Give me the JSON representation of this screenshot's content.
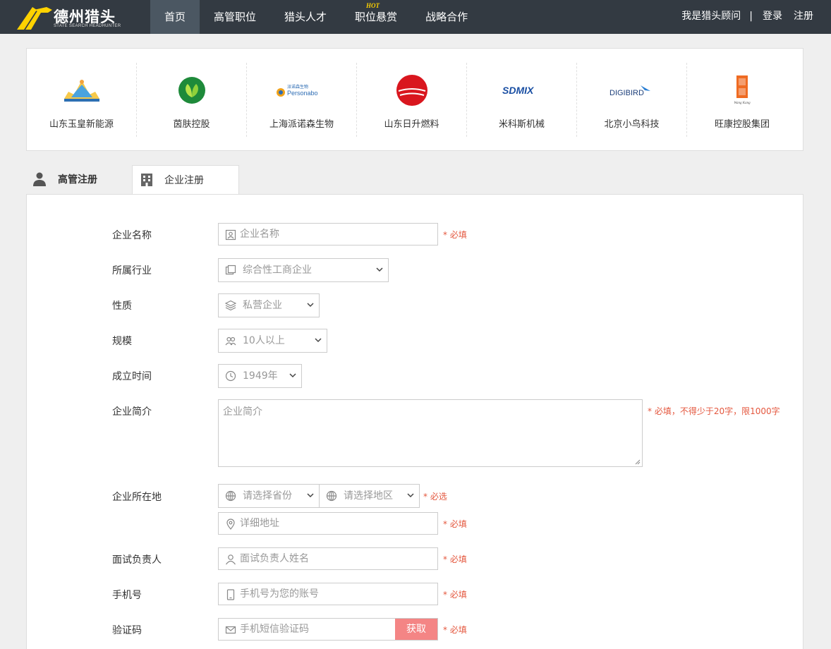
{
  "header": {
    "logo_text": "德州猎头",
    "logo_sub": "STATE SEARCH HEADHUNTER",
    "nav": [
      {
        "label": "首页",
        "active": true
      },
      {
        "label": "高管职位"
      },
      {
        "label": "猎头人才"
      },
      {
        "label": "职位悬赏",
        "badge": "HOT"
      },
      {
        "label": "战略合作"
      }
    ],
    "consultant_link": "我是猎头顾问",
    "separator": "|",
    "login": "登录",
    "register": "注册"
  },
  "partners": [
    {
      "name": "山东玉皇新能源",
      "logo": "yuhuang-logo"
    },
    {
      "name": "茵肤控股",
      "logo": "leaf-logo"
    },
    {
      "name": "上海派诺森生物",
      "logo": "personabo-logo",
      "logo_text": "Personabo",
      "logo_cn": "派诺森生物"
    },
    {
      "name": "山东日升燃料",
      "logo": "sun-logo"
    },
    {
      "name": "米科斯机械",
      "logo": "sdmix-logo",
      "logo_text": "SDMIX"
    },
    {
      "name": "北京小鸟科技",
      "logo": "digibird-logo",
      "logo_text": "DIGIBIRD"
    },
    {
      "name": "旺康控股集团",
      "logo": "wangkang-logo",
      "logo_text": "Wang Kang"
    }
  ],
  "tabs": {
    "exec": "高管注册",
    "corp": "企业注册"
  },
  "form": {
    "company_name": {
      "label": "企业名称",
      "placeholder": "企业名称",
      "hint": "* 必填"
    },
    "industry": {
      "label": "所属行业",
      "value": "综合性工商企业"
    },
    "nature": {
      "label": "性质",
      "value": "私营企业"
    },
    "scale": {
      "label": "规模",
      "value": "10人以上"
    },
    "founded": {
      "label": "成立时间",
      "value": "1949年"
    },
    "intro": {
      "label": "企业简介",
      "placeholder": "企业简介",
      "hint": "* 必填，不得少于20字，限1000字"
    },
    "location": {
      "label": "企业所在地",
      "province": "请选择省份",
      "region": "请选择地区",
      "hint": "* 必选",
      "address_placeholder": "详细地址",
      "address_hint": "* 必填"
    },
    "interviewer": {
      "label": "面试负责人",
      "placeholder": "面试负责人姓名",
      "hint": "* 必填"
    },
    "phone": {
      "label": "手机号",
      "placeholder": "手机号为您的账号",
      "hint": "* 必填"
    },
    "code": {
      "label": "验证码",
      "placeholder": "手机短信验证码",
      "button": "获取",
      "hint": "* 必填"
    }
  },
  "colors": {
    "nav_bg": "#333a42",
    "nav_active": "#4b5762",
    "required": "#e4573e",
    "get_code_button": "#f48585",
    "hot_badge": "#ffd200"
  }
}
